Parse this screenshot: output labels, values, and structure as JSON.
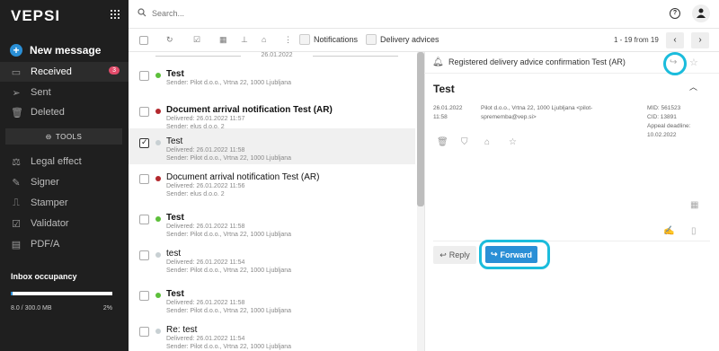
{
  "app": {
    "logo": "VEPSI"
  },
  "sidebar": {
    "new_message": "New message",
    "items": [
      {
        "label": "Received",
        "icon": "inbox-icon",
        "badge": "3",
        "active": true
      },
      {
        "label": "Sent",
        "icon": "send-icon"
      },
      {
        "label": "Deleted",
        "icon": "trash-icon"
      }
    ],
    "tools_label": "TOOLS",
    "tools": [
      {
        "label": "Legal effect",
        "icon": "gavel-icon"
      },
      {
        "label": "Signer",
        "icon": "pen-icon"
      },
      {
        "label": "Stamper",
        "icon": "stamp-icon"
      },
      {
        "label": "Validator",
        "icon": "check-icon"
      },
      {
        "label": "PDF/A",
        "icon": "pdf-icon"
      }
    ],
    "occupancy": {
      "title": "Inbox occupancy",
      "value": "8.0 / 300.0 MB",
      "percent_label": "2%",
      "fraction": 0.02
    }
  },
  "search": {
    "placeholder": "Search..."
  },
  "toolbar": {
    "filters": [
      "Notifications",
      "Delivery advices"
    ],
    "pager": "1 - 19 from 19",
    "prev": "‹",
    "next": "›"
  },
  "list": {
    "date_separator": "26.01.2022",
    "rows": [
      {
        "subject": "Test",
        "bold": true,
        "dot": "#5cbf3a",
        "delivered": "",
        "sender": "Sender: Pilot d.o.o., Vrtna 22, 1000 Ljubljana",
        "checked": false
      },
      {
        "subject": "Document arrival notification Test (AR)",
        "bold": true,
        "dot": "#b3282d",
        "delivered": "Delivered: 26.01.2022 11:57",
        "sender": "Sender: elus d.o.o. 2",
        "checked": false
      },
      {
        "subject": "Test",
        "bold": false,
        "dot": "#c8d0d3",
        "delivered": "Delivered: 26.01.2022 11:58",
        "sender": "Sender: Pilot d.o.o., Vrtna 22, 1000 Ljubljana",
        "checked": true
      },
      {
        "subject": "Document arrival notification Test (AR)",
        "bold": false,
        "dot": "#b3282d",
        "delivered": "Delivered: 26.01.2022 11:56",
        "sender": "Sender: elus d.o.o. 2",
        "checked": false
      },
      {
        "subject": "Test",
        "bold": true,
        "dot": "#5cbf3a",
        "delivered": "Delivered: 26.01.2022 11:58",
        "sender": "Sender: Pilot d.o.o., Vrtna 22, 1000 Ljubljana",
        "checked": false
      },
      {
        "subject": "test",
        "bold": false,
        "dot": "#c8d0d3",
        "delivered": "Delivered: 26.01.2022 11:54",
        "sender": "Sender: Pilot d.o.o., Vrtna 22, 1000 Ljubljana",
        "checked": false
      },
      {
        "subject": "Test",
        "bold": true,
        "dot": "#5cbf3a",
        "delivered": "Delivered: 26.01.2022 11:58",
        "sender": "Sender: Pilot d.o.o., Vrtna 22, 1000 Ljubljana",
        "checked": false
      },
      {
        "subject": "Re: test",
        "bold": false,
        "dot": "#c8d0d3",
        "delivered": "Delivered: 26.01.2022 11:54",
        "sender": "Sender: Pilot d.o.o., Vrtna 22, 1000 Ljubljana",
        "checked": false
      }
    ]
  },
  "detail": {
    "top_title": "Registered delivery advice confirmation Test (AR)",
    "subject": "Test",
    "date": "26.01.2022",
    "time": "11:58",
    "from_line1": "Pilot d.o.o., Vrtna 22, 1000 Ljubljana <pilot-",
    "from_line2": "sprememba@vep.si>",
    "mid": "MID: 561523",
    "cid": "CID: 13891",
    "appeal_label": "Appeal deadline:",
    "appeal_date": "10.02.2022",
    "reply": "Reply",
    "forward": "Forward"
  },
  "colors": {
    "accent": "#2a8fd6",
    "highlight": "#1bbcdc",
    "sidebar_bg": "#1f1f1f",
    "badge": "#e24b6a"
  }
}
